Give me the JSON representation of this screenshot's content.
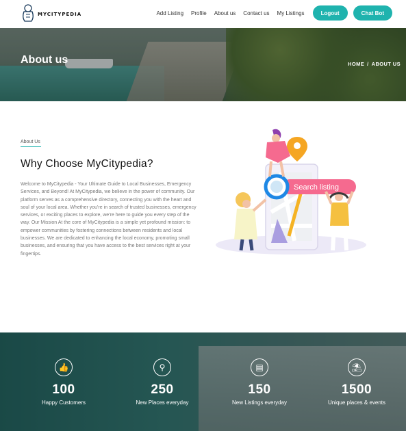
{
  "navbar": {
    "brand": "MYCITYPEDIA",
    "links": [
      "Add Listing",
      "Profile",
      "About us",
      "Contact us",
      "My Listings"
    ],
    "buttons": [
      "Logout",
      "Chat Bot"
    ]
  },
  "hero": {
    "title": "About us",
    "breadcrumb": [
      "HOME",
      "ABOUT US"
    ]
  },
  "about": {
    "label": "About Us",
    "heading": "Why Choose MyCitypedia?",
    "body": "Welcome to MyCitypedia - Your Ultimate Guide to Local Businesses, Emergency Services, and Beyond! At MyCitypedia, we believe in the power of community. Our platform serves as a comprehensive directory, connecting you with the heart and soul of your local area. Whether you're in search of trusted businesses, emergency services, or exciting places to explore, we're here to guide you every step of the way. Our Mission At the core of MyCitypedia is a simple yet profound mission: to empower communities by fostering connections between residents and local businesses. We are dedicated to enhancing the local economy, promoting small businesses, and ensuring that you have access to the best services right at your fingertips.",
    "illustration_search": "Search listing"
  },
  "stats": [
    {
      "icon": "thumbs-up-icon",
      "glyph": "👍",
      "value": "100",
      "label": "Happy Customers"
    },
    {
      "icon": "map-pin-icon",
      "glyph": "⚲",
      "value": "250",
      "label": "New Places everyday"
    },
    {
      "icon": "book-icon",
      "glyph": "▤",
      "value": "150",
      "label": "New Listings everyday"
    },
    {
      "icon": "palm-tree-icon",
      "glyph": "⛱",
      "value": "1500",
      "label": "Unique places & events"
    }
  ],
  "colors": {
    "accent": "#1fb3ae",
    "pink": "#f56a8f",
    "orange": "#f5a623"
  }
}
